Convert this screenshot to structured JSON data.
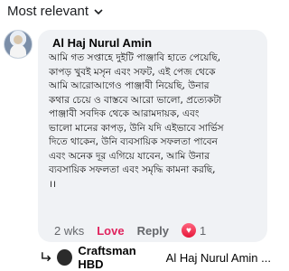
{
  "sort": {
    "label": "Most relevant"
  },
  "comment": {
    "author": "Al Haj Nurul Amin",
    "text": "আমি গত সপ্তাহে দুইটি পাঞ্জাবি হাতে পেয়েছি,\nকাপড় খুবই মসৃন এবং সফট, এই পেজ থেকে\nআমি আরোআগেও পাঞ্জাবী নিয়েছি, উনার\nকথার চেয়ে ও বাস্তবে আরো ভালো, প্রত্যেকটা\nপাঞ্জাবী সবদিক থেকে আরামদায়ক, এবং\nভালো মানের কাপড়, উনি যদি এইভাবে সার্ভিস\nদিতে থাকেন, উনি ব্যবসায়িক সফলতা পাবেন\nএবং অনেক দূর এগিয়ে যাবেন, আমি উনার\nব্যবসায়িক সফলতা এবং সমৃদ্ধি কামনা করছি,\n।।",
    "time": "2 wks",
    "love_label": "Love",
    "reply_label": "Reply",
    "reaction_count": "1"
  },
  "reply": {
    "author": "Craftsman HBD",
    "preview": "Al Haj Nurul Amin ..."
  }
}
